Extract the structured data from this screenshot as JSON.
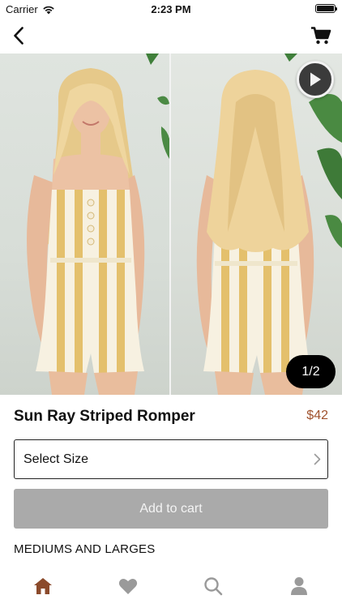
{
  "status_bar": {
    "carrier": "Carrier",
    "time": "2:23 PM"
  },
  "nav": {
    "back_icon": "chevron-left-icon",
    "cart_icon": "cart-icon"
  },
  "gallery": {
    "page_indicator": "1/2",
    "play_icon": "play-icon",
    "photos": [
      "model-front-view",
      "model-back-view"
    ]
  },
  "product": {
    "title": "Sun Ray Striped Romper",
    "price": "$42"
  },
  "size_select": {
    "label": "Select Size"
  },
  "add_to_cart": {
    "label": "Add to cart"
  },
  "description": "MEDIUMS AND LARGES",
  "tab_bar": {
    "tabs": [
      {
        "icon": "home-icon",
        "active": true
      },
      {
        "icon": "heart-icon",
        "active": false
      },
      {
        "icon": "search-icon",
        "active": false
      },
      {
        "icon": "profile-icon",
        "active": false
      }
    ],
    "active_color": "#8b4a2b",
    "inactive_color": "#9a9a9a"
  },
  "colors": {
    "price": "#a0522d",
    "button_disabled": "#aaaaaa"
  }
}
